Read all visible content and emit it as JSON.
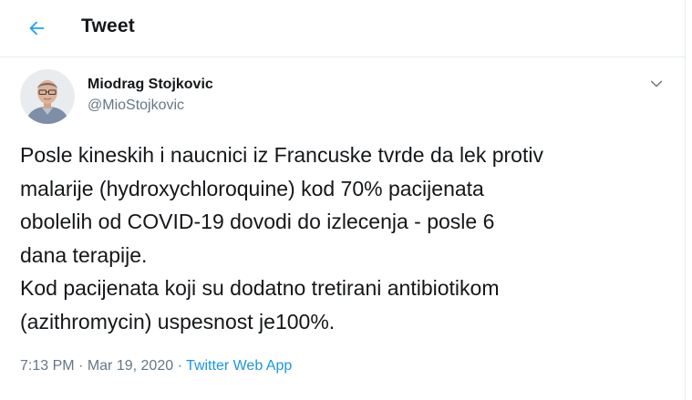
{
  "header": {
    "title": "Tweet",
    "back_icon": "arrow-left-icon",
    "accent_color": "#1da1f2"
  },
  "tweet": {
    "author": {
      "name": "Miodrag Stojkovic",
      "handle": "@MioStojkovic",
      "avatar_icon": "profile-photo"
    },
    "menu_icon": "chevron-down-icon",
    "text_lines": [
      "Posle kineskih i naucnici iz Francuske tvrde da lek protiv",
      "malarije (hydroxychloroquine) kod 70% pacijenata",
      "obolelih od COVID-19 dovodi do izlecenja - posle 6",
      "dana terapije.",
      "Kod pacijenata koji su dodatno tretirani antibiotikom",
      "(azithromycin) uspesnost je100%."
    ],
    "time": "7:13 PM",
    "separator": "·",
    "date": "Mar 19, 2020",
    "source": "Twitter Web App",
    "link_color": "#1b95e0"
  }
}
